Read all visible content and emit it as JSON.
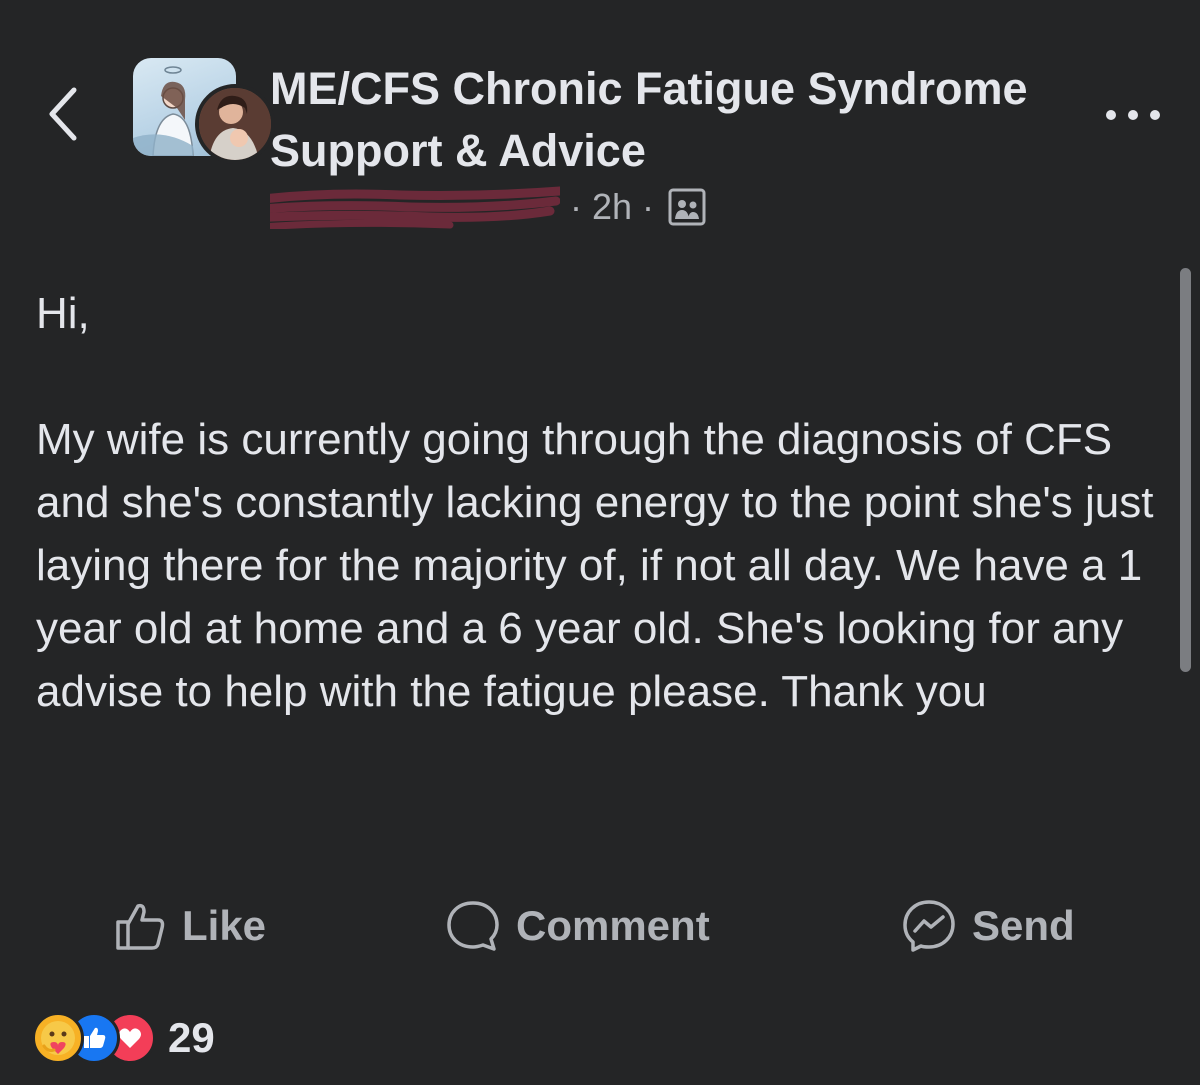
{
  "header": {
    "group_name": "ME/CFS Chronic Fatigue Syndrome Support & Advice",
    "separator": "·",
    "time": "2h",
    "author_icon": "redacted-author-name",
    "audience_icon": "group-members-icon",
    "more_icon": "more-options-icon",
    "back_icon": "chevron-left-icon"
  },
  "post": {
    "greeting": "Hi,",
    "body": "My wife is currently going through the diagnosis of CFS and she's constantly lacking energy to the point she's just laying there for the majority of, if not all day. We have a 1 year old at home and a 6 year old. She's looking for any advise to help with the fatigue please. Thank you"
  },
  "actions": {
    "like_label": "Like",
    "comment_label": "Comment",
    "send_label": "Send"
  },
  "reactions": {
    "types": [
      "care",
      "like",
      "love"
    ],
    "count": "29"
  },
  "colors": {
    "background": "#242526",
    "primary_text": "#e4e6eb",
    "secondary_text": "#b0b3b8",
    "like_blue": "#1877f2",
    "love_red": "#f33e58",
    "care_yellow": "#f7b125",
    "redaction": "#6b2a3a"
  }
}
